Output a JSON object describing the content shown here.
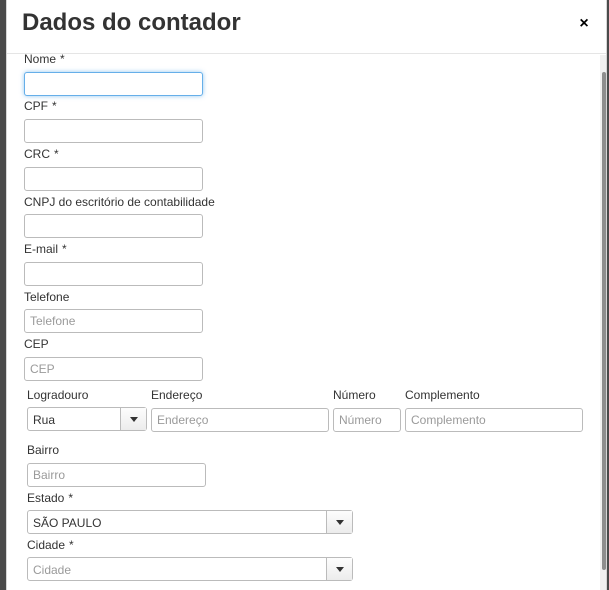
{
  "modal": {
    "title": "Dados do contador",
    "close_glyph": "×"
  },
  "form": {
    "required_mark": "*",
    "nome": {
      "label": "Nome",
      "value": "",
      "placeholder": ""
    },
    "cpf": {
      "label": "CPF",
      "value": "",
      "placeholder": ""
    },
    "crc": {
      "label": "CRC",
      "value": "",
      "placeholder": ""
    },
    "cnpj": {
      "label": "CNPJ do escritório de contabilidade",
      "value": "",
      "placeholder": ""
    },
    "email": {
      "label": "E-mail",
      "value": "",
      "placeholder": ""
    },
    "telefone": {
      "label": "Telefone",
      "placeholder": "Telefone"
    },
    "cep": {
      "label": "CEP",
      "placeholder": "CEP"
    },
    "logradouro": {
      "label": "Logradouro",
      "selected": "Rua"
    },
    "endereco": {
      "label": "Endereço",
      "placeholder": "Endereço"
    },
    "numero": {
      "label": "Número",
      "placeholder": "Número"
    },
    "complemento": {
      "label": "Complemento",
      "placeholder": "Complemento"
    },
    "bairro": {
      "label": "Bairro",
      "placeholder": "Bairro"
    },
    "estado": {
      "label": "Estado",
      "selected": "SÃO PAULO"
    },
    "cidade": {
      "label": "Cidade",
      "placeholder": "Cidade"
    }
  },
  "icons": {
    "close": "close-icon",
    "dropdown": "chevron-down-icon"
  },
  "colors": {
    "focus_border": "#66afe9",
    "title_text": "#333333"
  }
}
